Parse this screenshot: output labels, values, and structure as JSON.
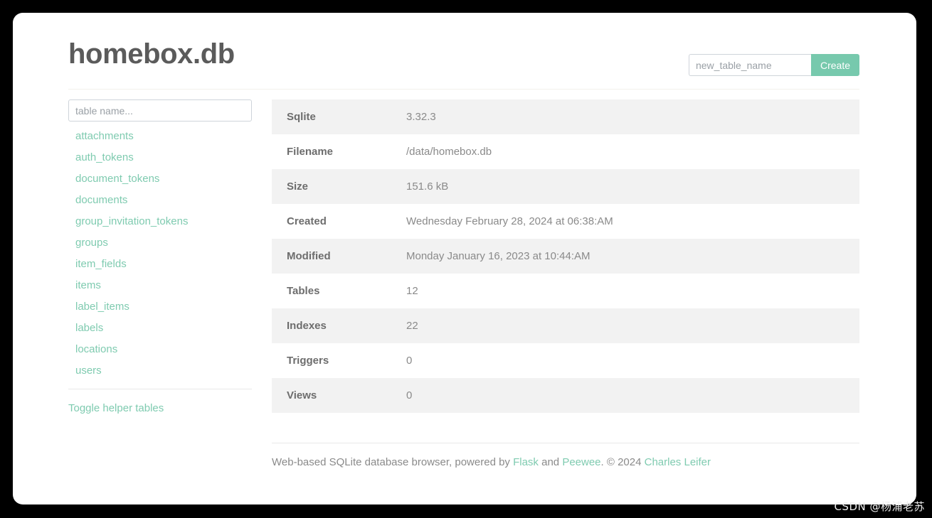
{
  "header": {
    "title": "homebox.db",
    "create_form": {
      "input_value": "",
      "input_placeholder": "new_table_name",
      "button_label": "Create"
    }
  },
  "sidebar": {
    "filter": {
      "value": "",
      "placeholder": "table name..."
    },
    "tables": [
      {
        "label": "attachments"
      },
      {
        "label": "auth_tokens"
      },
      {
        "label": "document_tokens"
      },
      {
        "label": "documents"
      },
      {
        "label": "group_invitation_tokens"
      },
      {
        "label": "groups"
      },
      {
        "label": "item_fields"
      },
      {
        "label": "items"
      },
      {
        "label": "label_items"
      },
      {
        "label": "labels"
      },
      {
        "label": "locations"
      },
      {
        "label": "users"
      }
    ],
    "toggle_helper_label": "Toggle helper tables"
  },
  "main": {
    "info_rows": [
      {
        "label": "Sqlite",
        "value": "3.32.3"
      },
      {
        "label": "Filename",
        "value": "/data/homebox.db"
      },
      {
        "label": "Size",
        "value": "151.6 kB"
      },
      {
        "label": "Created",
        "value": "Wednesday February 28, 2024 at 06:38:AM"
      },
      {
        "label": "Modified",
        "value": "Monday January 16, 2023 at 10:44:AM"
      },
      {
        "label": "Tables",
        "value": "12"
      },
      {
        "label": "Indexes",
        "value": "22"
      },
      {
        "label": "Triggers",
        "value": "0"
      },
      {
        "label": "Views",
        "value": "0"
      }
    ]
  },
  "footer": {
    "text_1": "Web-based SQLite database browser, powered by ",
    "link_flask": "Flask",
    "text_2": " and ",
    "link_peewee": "Peewee",
    "text_3": ". © 2024 ",
    "link_author": "Charles Leifer"
  },
  "watermark": {
    "text": "CSDN @杨浦老苏"
  },
  "colors": {
    "accent": "#77c9ad",
    "link": "#7fcbb0",
    "label_text": "#6d6d6d",
    "value_text": "#8a8a8a",
    "row_alt_bg": "#f2f2f2",
    "page_bg": "#ffffff",
    "backdrop": "#000000"
  }
}
